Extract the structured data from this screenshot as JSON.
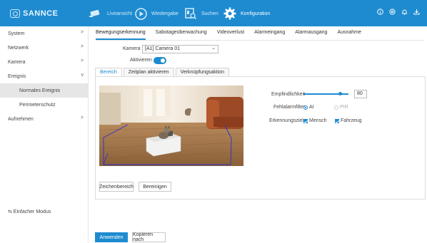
{
  "brand": {
    "name": "SANNCE",
    "accent": "#1e8bd0"
  },
  "nav": {
    "items": [
      {
        "label": "Liveansicht",
        "icon": "camera-icon"
      },
      {
        "label": "Wiedergabe",
        "icon": "play-icon"
      },
      {
        "label": "Suchen",
        "icon": "search-doc-icon"
      },
      {
        "label": "Konfiguration",
        "icon": "gear-icon"
      }
    ],
    "active": "Konfiguration"
  },
  "top_icons": [
    "info-icon",
    "settings-icon",
    "bell-icon",
    "download-icon"
  ],
  "sidebar": {
    "items": [
      {
        "label": "System",
        "arrow": ">"
      },
      {
        "label": "Netzwerk",
        "arrow": ">"
      },
      {
        "label": "Kamera",
        "arrow": ">"
      },
      {
        "label": "Ereignis",
        "arrow": "v"
      },
      {
        "label": "Normales Ereignis",
        "arrow": ""
      },
      {
        "label": "Perimeterschutz",
        "arrow": ""
      },
      {
        "label": "Aufnehmen",
        "arrow": ">"
      }
    ],
    "selected": "Normales Ereignis",
    "simple_mode": "⇆ Einfacher Modus"
  },
  "main_tabs": [
    "Bewegungserkennung",
    "Sabotageüberwachung",
    "Videoverlust",
    "Alarmeingang",
    "Alarmausgang",
    "Ausnahme"
  ],
  "active_main_tab": "Bewegungserkennung",
  "camera": {
    "label": "Kamera",
    "value": "[A1] Camera 01"
  },
  "enable": {
    "label": "Aktivieren",
    "on": true
  },
  "sub_tabs": [
    "Bereich",
    "Zeitplan aktivieren",
    "Verknüpfungsaktion"
  ],
  "active_sub_tab": "Bereich",
  "settings": {
    "sensitivity_label": "Empfindlichkeit",
    "sensitivity_value": "80",
    "sensitivity_fraction": 0.8,
    "false_alarm_label": "Fehlalarmfilter",
    "false_alarm_options": [
      "AI",
      "PIR"
    ],
    "false_alarm_selected": "AI",
    "target_label": "Erkennungsziel",
    "targets": [
      "Mensch",
      "Fahrzeug"
    ],
    "targets_checked": [
      "Mensch",
      "Fahrzeug"
    ]
  },
  "area_buttons": {
    "draw": "Zeichenbereich",
    "clear": "Bereinigen"
  },
  "footer_buttons": {
    "apply": "Anwenden",
    "copy": "Kopieren nach"
  }
}
